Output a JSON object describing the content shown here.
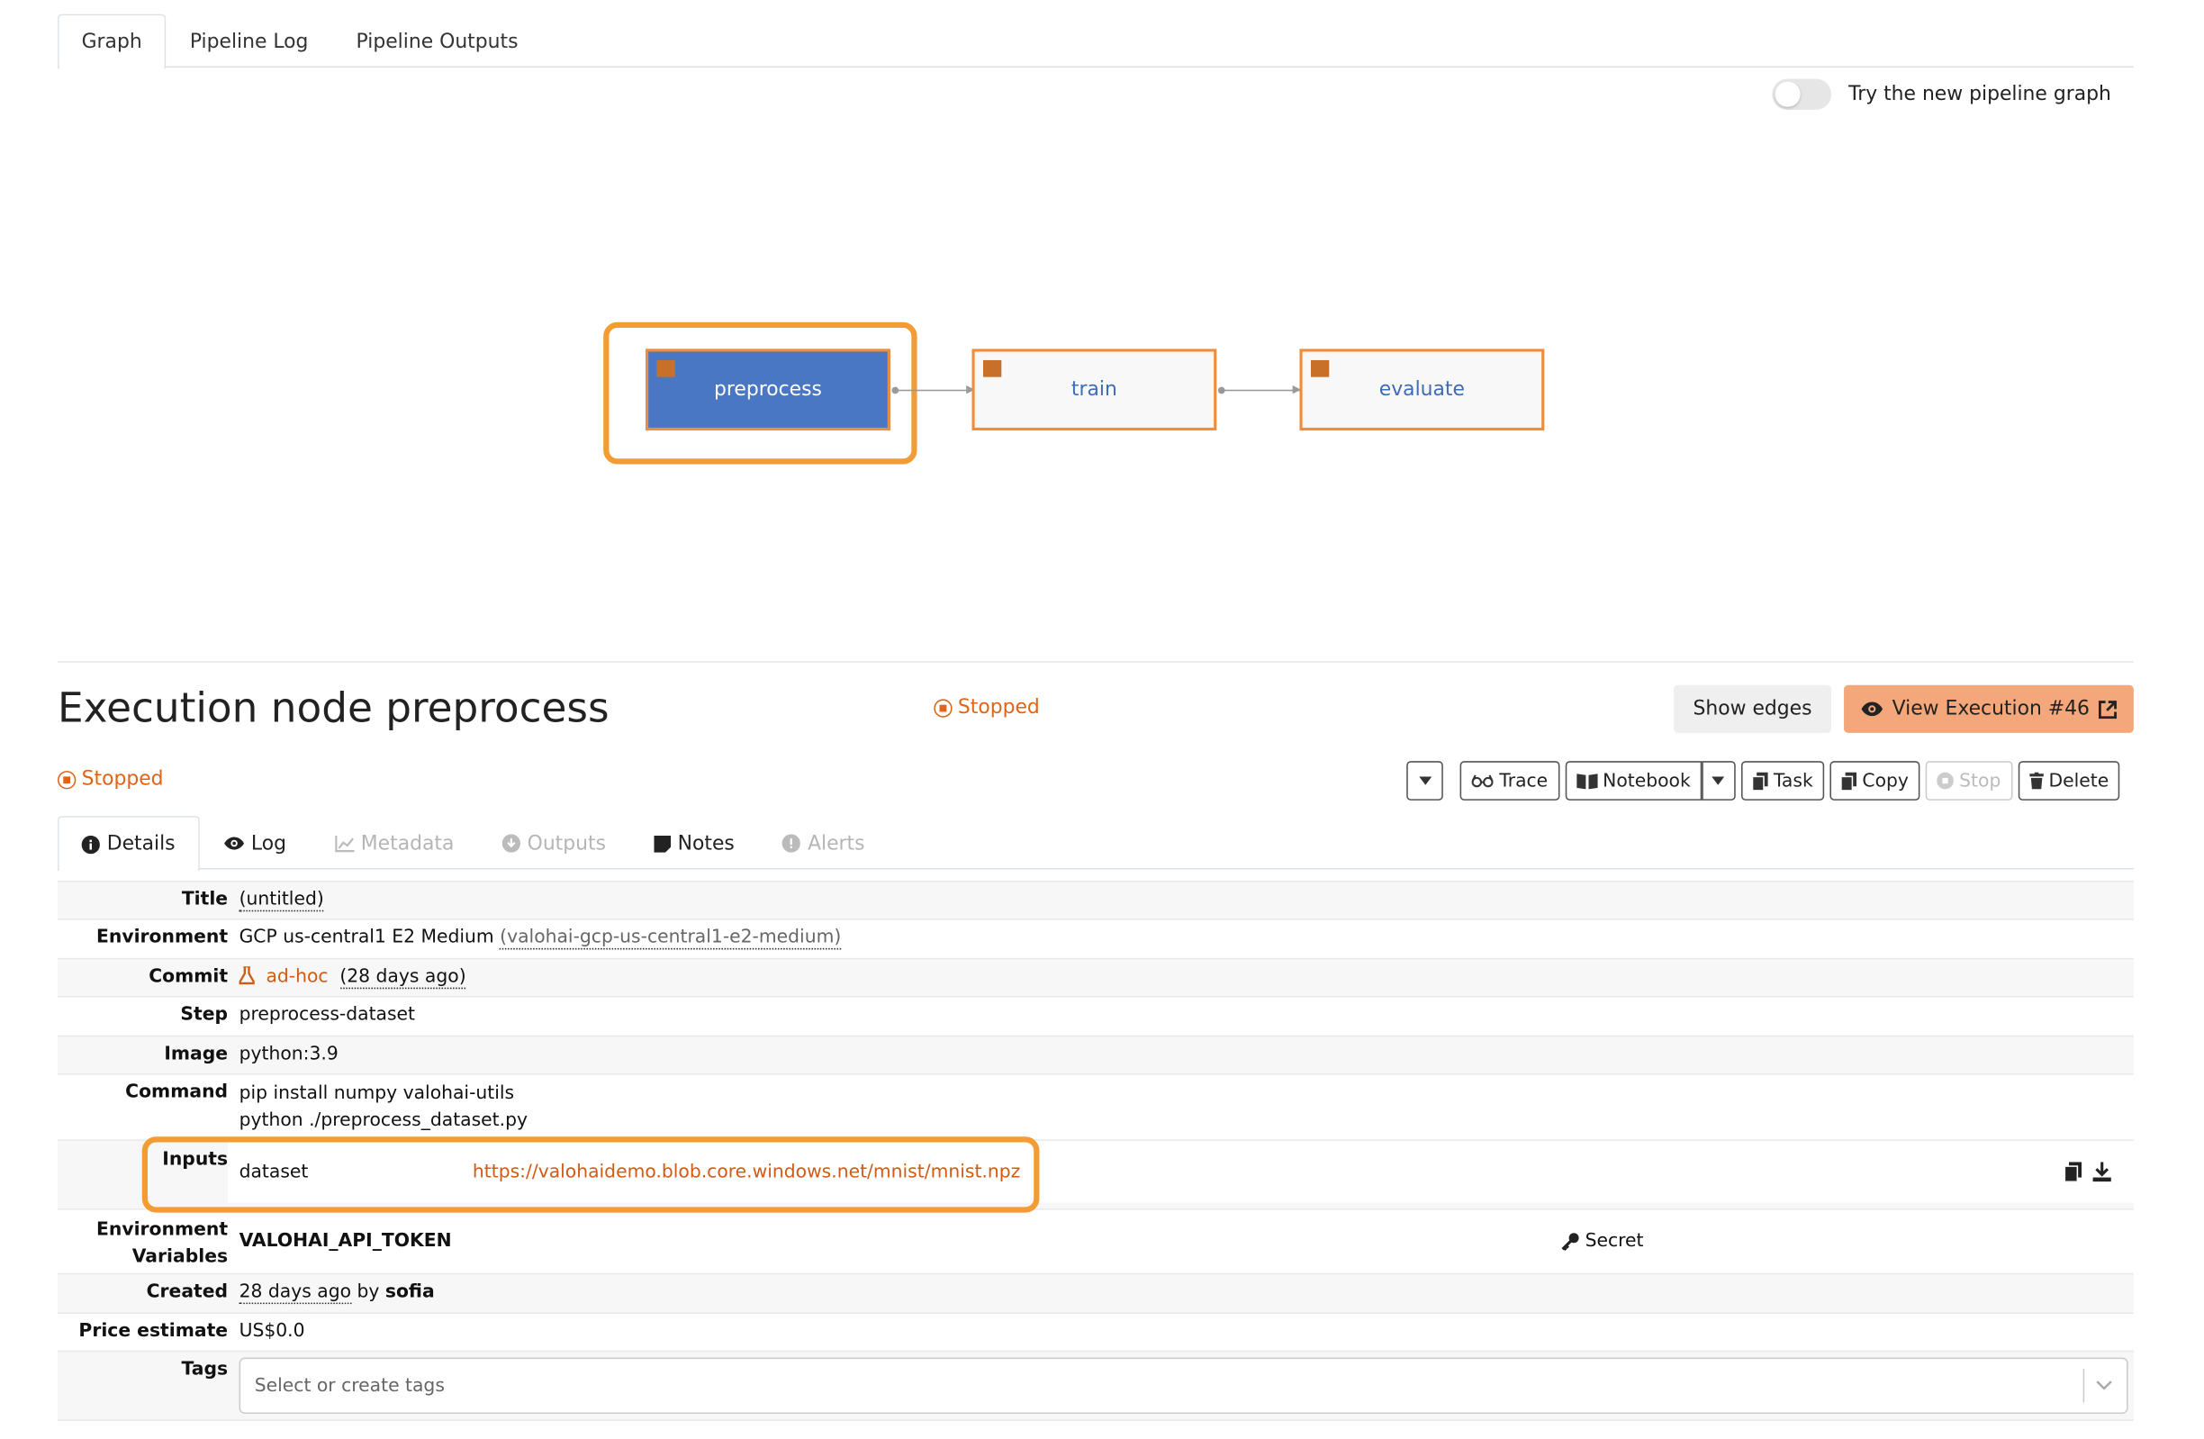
{
  "top_tabs": [
    {
      "label": "Graph"
    },
    {
      "label": "Pipeline Log"
    },
    {
      "label": "Pipeline Outputs"
    }
  ],
  "toggle": {
    "label": "Try the new pipeline graph",
    "on": false
  },
  "graph": {
    "nodes": [
      {
        "label": "preprocess",
        "selected": true
      },
      {
        "label": "train",
        "selected": false
      },
      {
        "label": "evaluate",
        "selected": false
      }
    ]
  },
  "node_panel": {
    "title": "Execution node preprocess",
    "status": "Stopped",
    "show_edges": "Show edges",
    "view_execution": "View Execution #46"
  },
  "execution": {
    "status": "Stopped",
    "actions": {
      "trace": "Trace",
      "notebook": "Notebook",
      "task": "Task",
      "copy": "Copy",
      "stop": "Stop",
      "delete": "Delete"
    },
    "tabs": [
      {
        "label": "Details"
      },
      {
        "label": "Log"
      },
      {
        "label": "Metadata"
      },
      {
        "label": "Outputs"
      },
      {
        "label": "Notes"
      },
      {
        "label": "Alerts"
      }
    ],
    "details": {
      "title_label": "Title",
      "title_value": "(untitled)",
      "environment_label": "Environment",
      "environment_value": "GCP us-central1 E2 Medium",
      "environment_slug": "(valohai-gcp-us-central1-e2-medium)",
      "commit_label": "Commit",
      "commit_value": "ad-hoc",
      "commit_age": "(28 days ago)",
      "step_label": "Step",
      "step_value": "preprocess-dataset",
      "image_label": "Image",
      "image_value": "python:3.9",
      "command_label": "Command",
      "command_lines": [
        "pip install numpy valohai-utils",
        "python ./preprocess_dataset.py"
      ],
      "inputs_label": "Inputs",
      "input_name": "dataset",
      "input_url": "https://valohaidemo.blob.core.windows.net/mnist/mnist.npz",
      "env_vars_label_1": "Environment",
      "env_vars_label_2": "Variables",
      "env_var_name": "VALOHAI_API_TOKEN",
      "env_var_value": "Secret",
      "created_label": "Created",
      "created_age": "28 days ago",
      "created_by_word": "by",
      "created_user": "sofia",
      "price_label": "Price estimate",
      "price_value": "US$0.0",
      "tags_label": "Tags",
      "tags_placeholder": "Select or create tags"
    }
  },
  "colors": {
    "accent_orange": "#f08c3a",
    "selected_node": "#4a77c3",
    "status_orange": "#e06416",
    "view_exec_bg": "#f4a77a"
  }
}
